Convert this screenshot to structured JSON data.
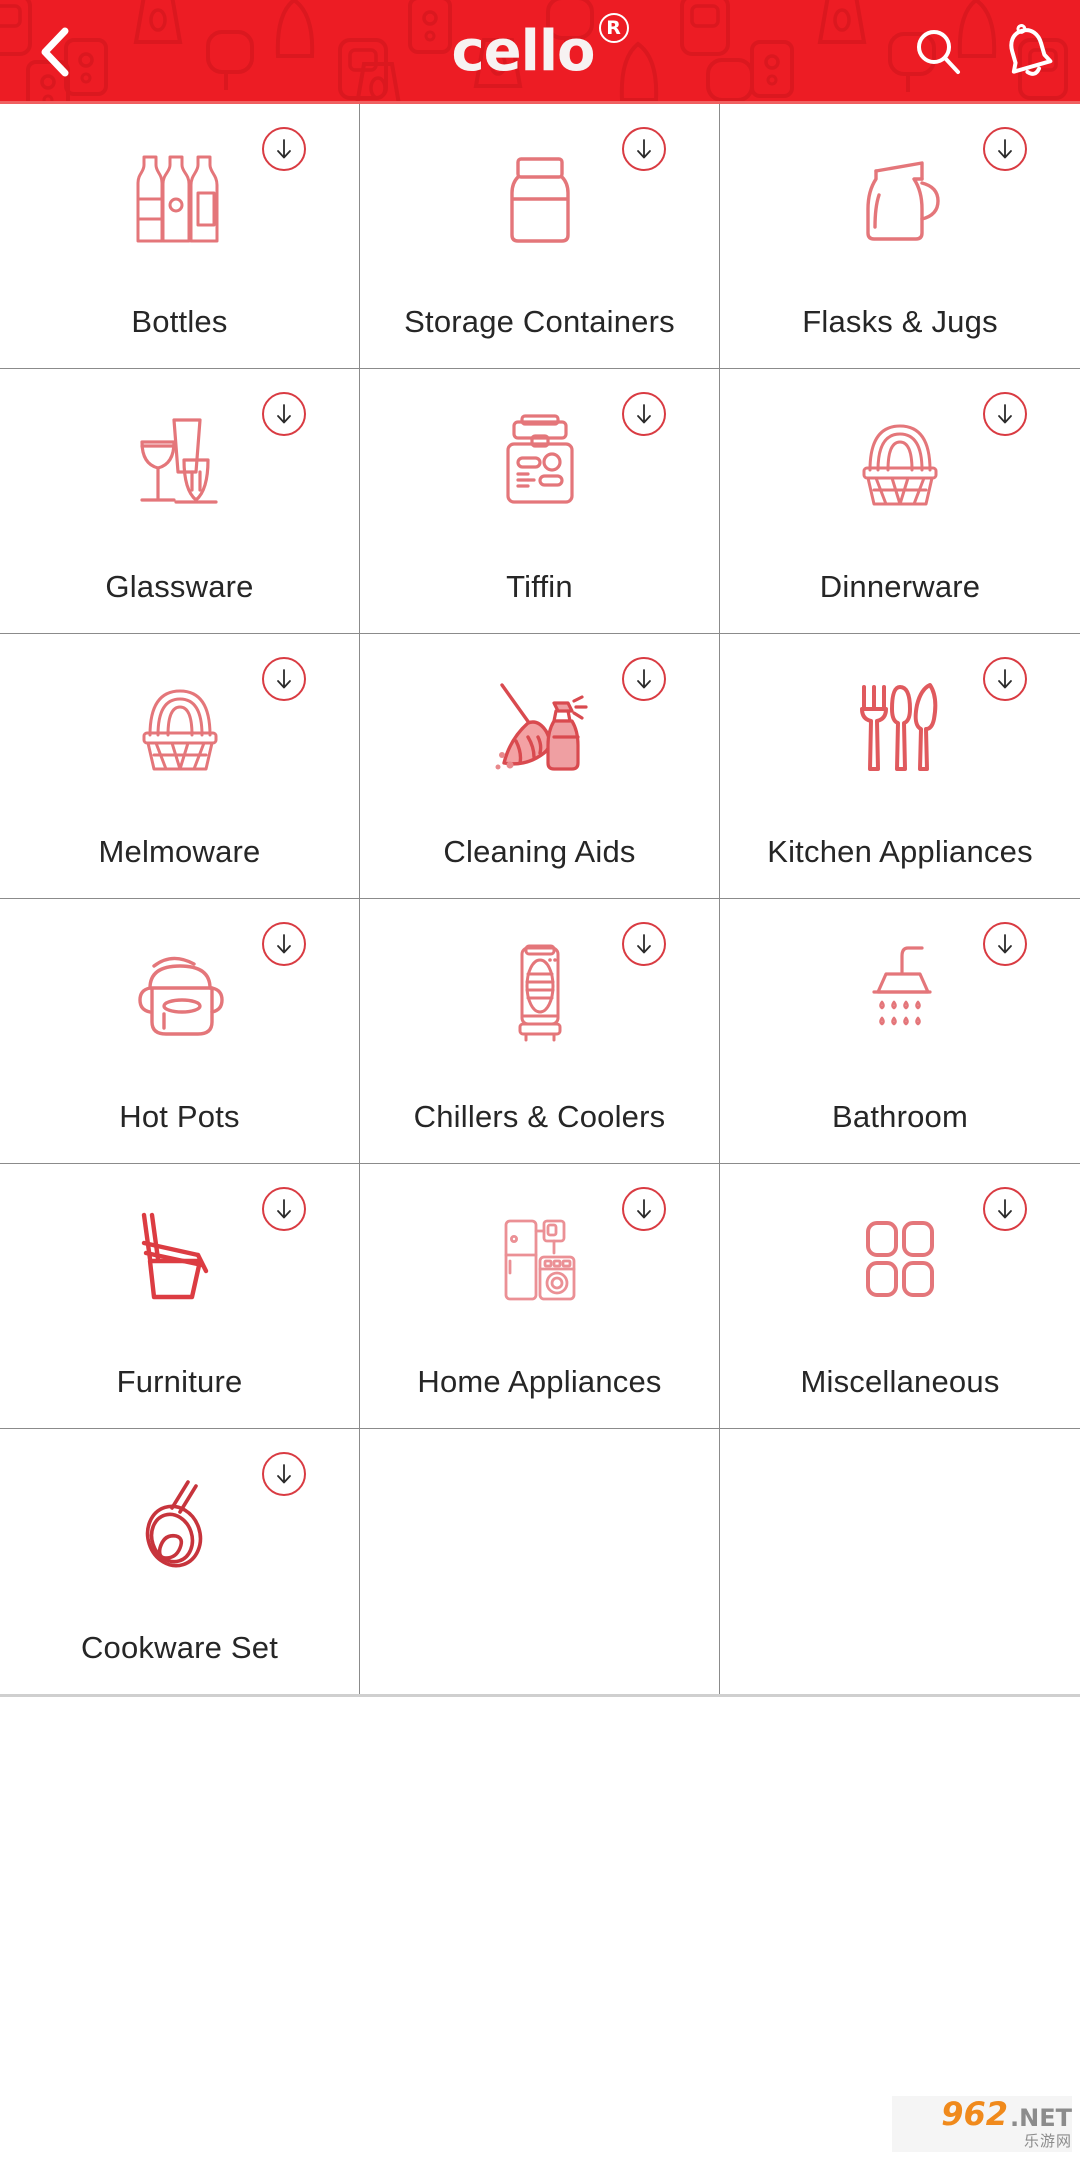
{
  "header": {
    "brand": "cello",
    "registered_mark": "R",
    "back_icon": "chevron-left-icon",
    "search_icon": "search-icon",
    "notification_icon": "bell-icon",
    "background_color": "#ED1C24"
  },
  "grid": {
    "columns": 3,
    "download_badge_icon": "download-arrow-icon",
    "icon_color": "#E05A5E",
    "label_color": "#262626",
    "items": [
      {
        "label": "Bottles",
        "icon": "bottles-icon"
      },
      {
        "label": "Storage Containers",
        "icon": "storage-container-icon"
      },
      {
        "label": "Flasks & Jugs",
        "icon": "jug-icon"
      },
      {
        "label": "Glassware",
        "icon": "glassware-icon"
      },
      {
        "label": "Tiffin",
        "icon": "tiffin-box-icon"
      },
      {
        "label": "Dinnerware",
        "icon": "dinnerware-basket-icon"
      },
      {
        "label": "Melmoware",
        "icon": "melmoware-basket-icon"
      },
      {
        "label": "Cleaning Aids",
        "icon": "broom-spray-icon"
      },
      {
        "label": "Kitchen Appliances",
        "icon": "cutlery-icon"
      },
      {
        "label": "Hot Pots",
        "icon": "hot-pot-icon"
      },
      {
        "label": "Chillers & Coolers",
        "icon": "cooler-icon"
      },
      {
        "label": "Bathroom",
        "icon": "shower-icon"
      },
      {
        "label": "Furniture",
        "icon": "chair-icon"
      },
      {
        "label": "Home Appliances",
        "icon": "fridge-washer-icon"
      },
      {
        "label": "Miscellaneous",
        "icon": "grid-squares-icon"
      },
      {
        "label": "Cookware Set",
        "icon": "frying-pan-icon"
      },
      {
        "label": "",
        "icon": ""
      },
      {
        "label": "",
        "icon": ""
      }
    ]
  },
  "watermark": {
    "number": "962",
    "domain": ".NET",
    "subtitle": "乐游网"
  }
}
